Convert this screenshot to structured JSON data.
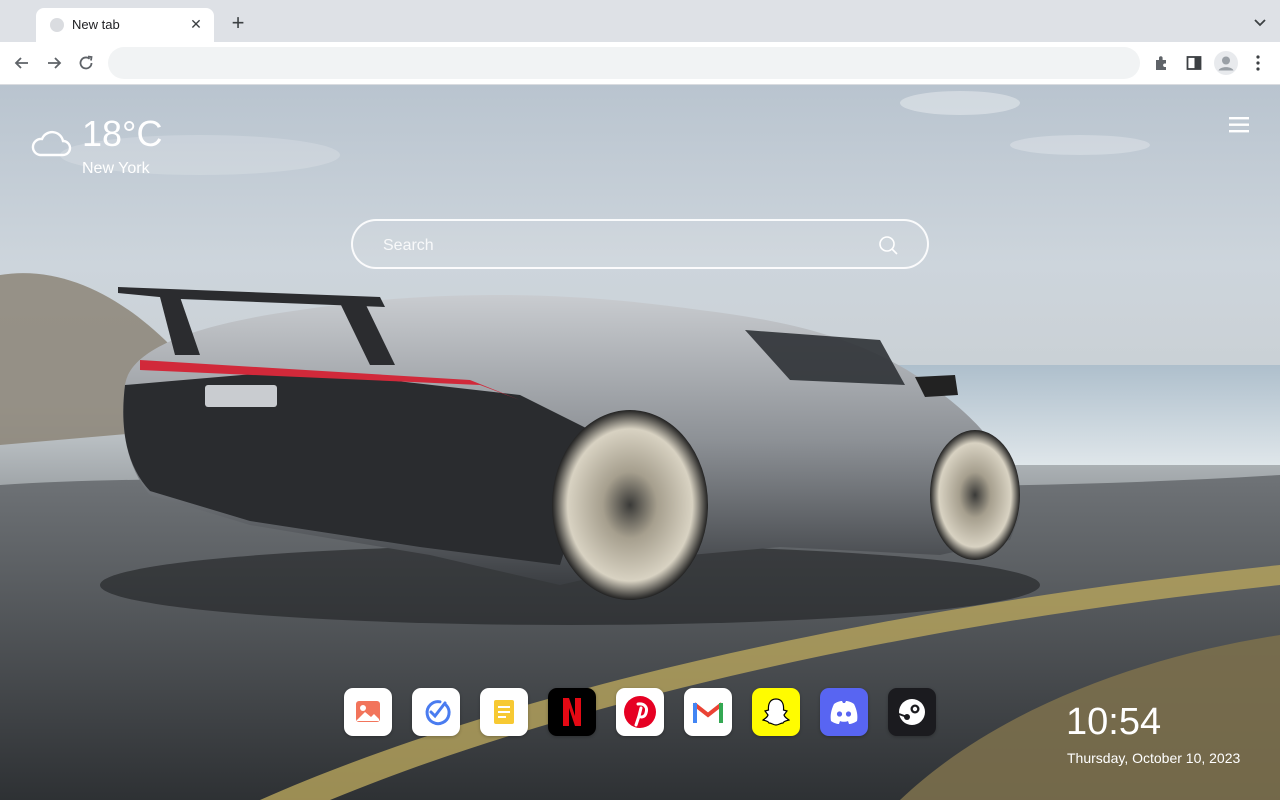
{
  "browser": {
    "tab_title": "New tab",
    "tab_close": "✕",
    "new_tab": "+",
    "address_value": "",
    "address_placeholder": ""
  },
  "weather": {
    "temperature": "18°C",
    "city": "New York",
    "icon": "cloud-icon"
  },
  "search": {
    "placeholder": "Search",
    "icon": "search-icon"
  },
  "dock": {
    "apps": [
      {
        "name": "photos",
        "icon": "image-icon",
        "color": "#ffffff"
      },
      {
        "name": "tasks",
        "icon": "check-circle-icon",
        "color": "#ffffff"
      },
      {
        "name": "notes",
        "icon": "notes-icon",
        "color": "#ffffff"
      },
      {
        "name": "netflix",
        "icon": "netflix-icon",
        "color": "#000000"
      },
      {
        "name": "pinterest",
        "icon": "pinterest-icon",
        "color": "#ffffff"
      },
      {
        "name": "gmail",
        "icon": "gmail-icon",
        "color": "#ffffff"
      },
      {
        "name": "snapchat",
        "icon": "snapchat-icon",
        "color": "#fffc00"
      },
      {
        "name": "discord",
        "icon": "discord-icon",
        "color": "#5865f2"
      },
      {
        "name": "steam",
        "icon": "steam-icon",
        "color": "#1b1b1f"
      }
    ]
  },
  "clock": {
    "time": "10:54",
    "date": "Thursday, October 10, 2023"
  }
}
